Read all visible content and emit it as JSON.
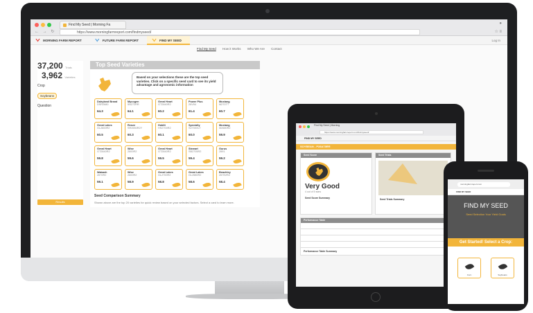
{
  "desktop": {
    "tab_title": "Find My Seed | Morning Fa",
    "address": "https://www.morningfarmreport.com/findmyseed/",
    "site_nav": [
      {
        "label": "MORNING FARM REPORT"
      },
      {
        "label": "FUTURE FARM REPORT"
      },
      {
        "label": "FIND MY SEED"
      }
    ],
    "login_label": "Log In",
    "sub_nav": [
      "Find My Seed",
      "How it Works",
      "Who We Are",
      "Contact"
    ],
    "sidebar": {
      "stat1_value": "37,200",
      "stat1_unit": "Trials",
      "stat2_value": "3,962",
      "stat2_unit": "Varieties",
      "crop_label": "Crop",
      "crop_chip": "Soybeans",
      "question_label": "Question",
      "results_button": "Results"
    },
    "panel_title": "Top Seed Varieties",
    "intro_text": "Based on your selections these are the top seed varieties. Click on a specific seed card to see its yield advantage and agronomic information",
    "cards": [
      {
        "name": "Dairyland Brand",
        "code": "DSR2680",
        "val": "64.3"
      },
      {
        "name": "Mycogen",
        "code": "5N272RR",
        "val": "64.1"
      },
      {
        "name": "Great Heart",
        "code": "GT2840R2",
        "val": "60.2"
      },
      {
        "name": "Power Plus",
        "code": "26V54",
        "val": "61.4"
      },
      {
        "name": "Mustang",
        "code": "M270TT",
        "val": "60.7"
      },
      {
        "name": "Great Lakes",
        "code": "GL2600R2",
        "val": "60.5"
      },
      {
        "name": "Renze",
        "code": "SR2650R2Y",
        "val": "60.3"
      },
      {
        "name": "Hoblit",
        "code": "HS2700R2",
        "val": "60.1"
      },
      {
        "name": "Specialty",
        "code": "S2700XLT",
        "val": "60.0"
      },
      {
        "name": "Mustang",
        "code": "M2680R2",
        "val": "59.9"
      },
      {
        "name": "Great Heart",
        "code": "GT2840R2",
        "val": "59.8"
      },
      {
        "name": "Wise",
        "code": "2600R2",
        "val": "59.6"
      },
      {
        "name": "Great Heart",
        "code": "GT2840R2",
        "val": "59.5"
      },
      {
        "name": "Stewart",
        "code": "SB2705R2",
        "val": "59.4"
      },
      {
        "name": "Gurus",
        "code": "2691",
        "val": "59.2"
      },
      {
        "name": "Wabash",
        "code": "2670R2",
        "val": "59.1"
      },
      {
        "name": "Wise",
        "code": "2600R2",
        "val": "58.9"
      },
      {
        "name": "Great Lakes",
        "code": "GL2700R2",
        "val": "58.8"
      },
      {
        "name": "Great Lakes",
        "code": "GL2580R2",
        "val": "58.6"
      },
      {
        "name": "Beachley",
        "code": "2675VR2",
        "val": "58.4"
      }
    ],
    "summary_title": "Seed Comparison Summary",
    "summary_text": "Shown above are the top 20 varieties for quick review based on your selected factors. Select a card to learn more."
  },
  "tablet": {
    "tab_title": "Find My Seed | Morning",
    "address": "https://www.morningfarmreport.com/findmyseed/",
    "header": "FIND MY SEED",
    "variety_title": "SOYBEAN - P28A78RR",
    "seed_score_label": "Seed Score",
    "seed_trials_label": "Seed Trials",
    "rating": "Very Good",
    "rating_sub": "4 out of 5 stars",
    "score_summary_label": "Seed Score Summary",
    "trials_summary_label": "Seed Trials Summary",
    "perf_label": "Performance Table",
    "perf_summary_label": "Performance Table Summary"
  },
  "phone": {
    "address": "morningfarmreport.com",
    "header": "FIND MY SEED",
    "hero_title": "FIND MY SEED",
    "hero_sub": "Seed Selection Your Yield Goals",
    "cta": "Get Started! Select a Crop:",
    "crop1": "Corn",
    "crop2": "Soybeans"
  }
}
